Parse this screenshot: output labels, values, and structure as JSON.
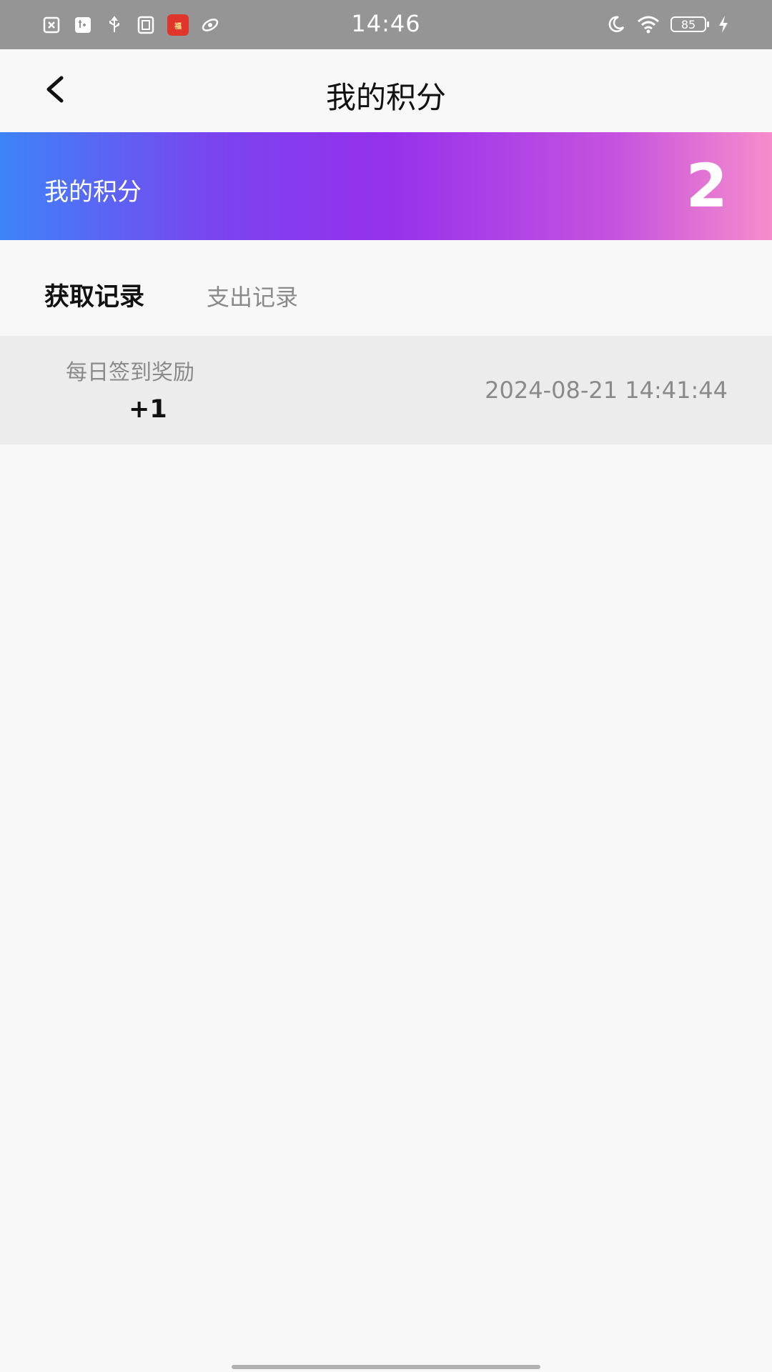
{
  "status_bar": {
    "time": "14:46",
    "battery": "85",
    "left_icons": [
      "close-box-icon",
      "usb-debug-icon",
      "usb-icon",
      "sim-icon",
      "red-app-icon",
      "link-icon"
    ],
    "right_icons": [
      "moon-icon",
      "wifi-icon",
      "battery-icon",
      "charging-bolt-icon"
    ],
    "background": "#959595"
  },
  "header": {
    "title": "我的积分",
    "back_icon": "chevron-left-icon"
  },
  "banner": {
    "label": "我的积分",
    "value": "2",
    "gradient": [
      "#3d84f8",
      "#9531ec",
      "#f78dcc"
    ]
  },
  "tabs": [
    {
      "label": "获取记录",
      "active": true
    },
    {
      "label": "支出记录",
      "active": false
    }
  ],
  "records": [
    {
      "title": "每日签到奖励",
      "points": "+1",
      "time": "2024-08-21 14:41:44"
    }
  ],
  "colors": {
    "page_bg": "#f8f8f9",
    "row_bg": "#ececed",
    "muted_text": "#8a8a8a",
    "primary_text": "#111111"
  }
}
